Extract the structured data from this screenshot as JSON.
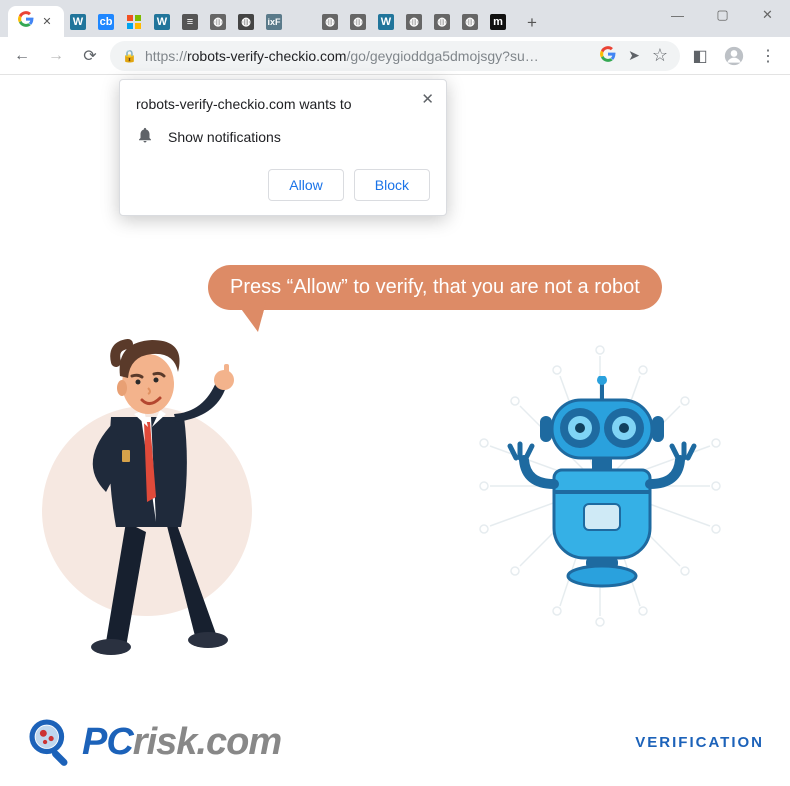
{
  "window": {
    "min": "—",
    "max": "▢",
    "close": "✕"
  },
  "tabs": {
    "active_icon": "G",
    "new_tab": "+",
    "active_close": "✕"
  },
  "toolbar": {
    "back": "←",
    "forward": "→",
    "reload": "⟳",
    "url_scheme": "https://",
    "url_host": "robots-verify-checkio.com",
    "url_path": "/go/geygioddga5dmojsgy?su…",
    "search_icon": "G",
    "share": "➤",
    "star": "☆",
    "ext": "◧",
    "profile": "◯",
    "menu": "⋮"
  },
  "permission": {
    "title_pre": "robots-verify-checkio.com",
    "title_post": " wants to",
    "line": "Show notifications",
    "allow": "Allow",
    "block": "Block",
    "close": "✕",
    "bell": "🔔"
  },
  "page": {
    "speech": "Press “Allow” to verify, that you are not a robot",
    "verification": "VERIFICATION",
    "logo_text_1": "PC",
    "logo_text_2": "risk.com"
  }
}
